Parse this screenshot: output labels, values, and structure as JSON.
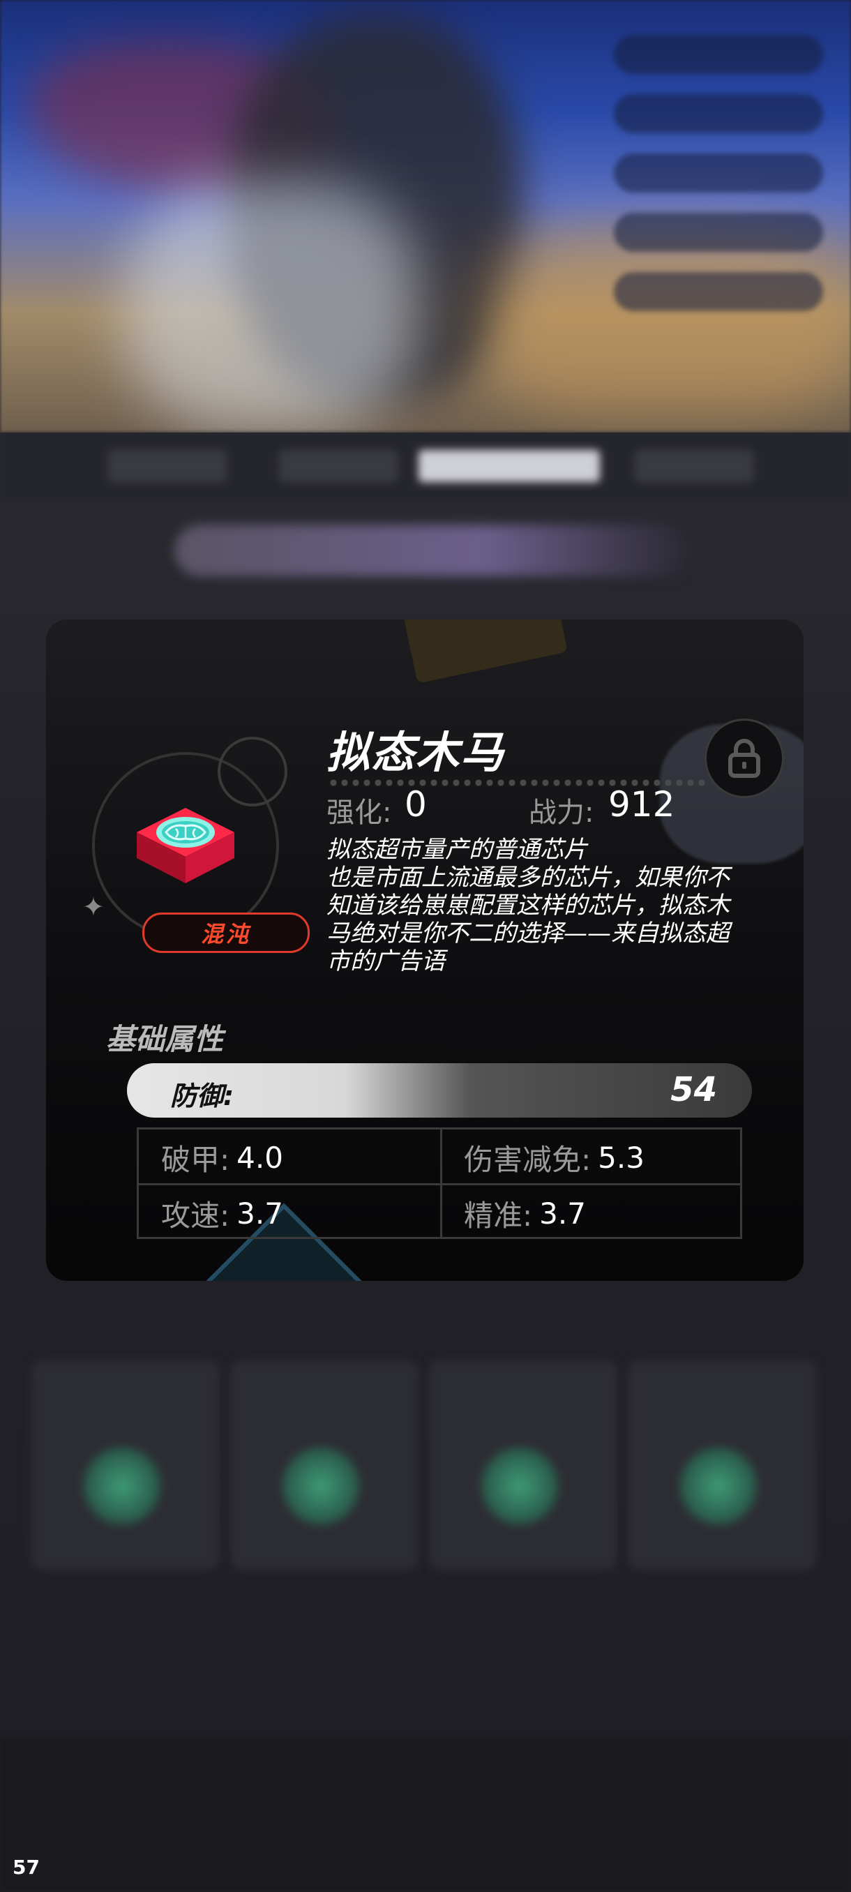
{
  "chip": {
    "name": "拟态木马",
    "enhance_label": "强化:",
    "enhance_value": "0",
    "power_label": "战力:",
    "power_value": "912",
    "rarity": "混沌",
    "description_lines": [
      "拟态超市量产的普通芯片",
      "也是市面上流通最多的芯片，如果你不",
      "知道该给崽崽配置这样的芯片，拟态木",
      "马绝对是你不二的选择——来自拟态超",
      "市的广告语"
    ]
  },
  "base_attributes": {
    "title": "基础属性",
    "main": {
      "label": "防御:",
      "value": "54"
    },
    "sub": [
      {
        "label": "破甲:",
        "value": "4.0"
      },
      {
        "label": "伤害减免:",
        "value": "5.3"
      },
      {
        "label": "攻速:",
        "value": "3.7"
      },
      {
        "label": "精准:",
        "value": "3.7"
      }
    ]
  },
  "overlay": {
    "fps_counter": "57"
  },
  "icons": {
    "lock": "lock-icon",
    "chip": "brain-chip-icon",
    "sparkle": "sparkle-icon"
  },
  "colors": {
    "rarity_red": "#e23a2a",
    "panel_bg": "#0d0d0f"
  }
}
